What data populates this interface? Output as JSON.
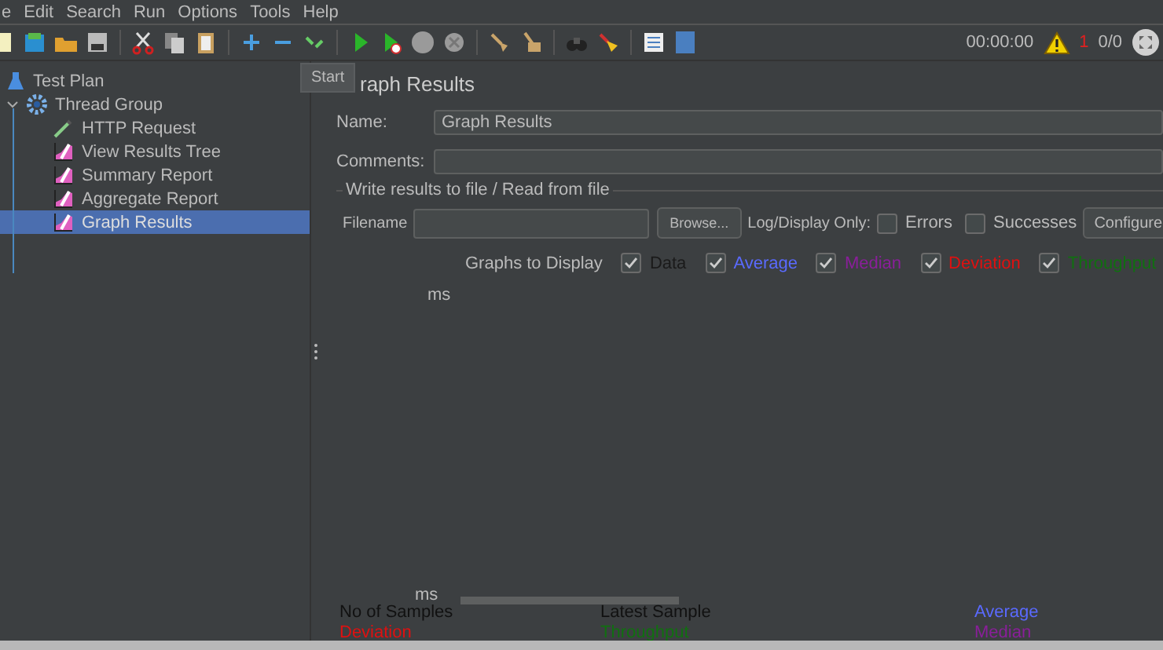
{
  "menu": [
    "e",
    "Edit",
    "Search",
    "Run",
    "Options",
    "Tools",
    "Help"
  ],
  "toolbar": {
    "tooltip": "Start",
    "timer": "00:00:00",
    "warning_count": "1",
    "threads": "0/0"
  },
  "tree": [
    {
      "label": "Test Plan",
      "kind": "plan",
      "selected": false
    },
    {
      "label": "Thread Group",
      "kind": "group",
      "expanded": true,
      "selected": false,
      "children": [
        {
          "label": "HTTP Request",
          "kind": "sampler",
          "selected": false
        },
        {
          "label": "View Results Tree",
          "kind": "listener",
          "selected": false
        },
        {
          "label": "Summary Report",
          "kind": "listener",
          "selected": false
        },
        {
          "label": "Aggregate Report",
          "kind": "listener",
          "selected": false
        },
        {
          "label": "Graph Results",
          "kind": "listener",
          "selected": true
        }
      ]
    }
  ],
  "panel": {
    "title": "raph Results",
    "name_label": "Name:",
    "name_value": "Graph Results",
    "comments_label": "Comments:",
    "file_group": "Write results to file / Read from file",
    "filename_label": "Filename",
    "browse": "Browse...",
    "log_label": "Log/Display Only:",
    "log_options": [
      {
        "label": "Errors",
        "checked": false
      },
      {
        "label": "Successes",
        "checked": false
      }
    ],
    "configure": "Configure",
    "graphs_label": "Graphs to Display",
    "graphs": [
      {
        "label": "Data",
        "checked": true,
        "color": "#1a1a1a"
      },
      {
        "label": "Average",
        "checked": true,
        "color": "#5a6aff"
      },
      {
        "label": "Median",
        "checked": true,
        "color": "#8a1f9a"
      },
      {
        "label": "Deviation",
        "checked": true,
        "color": "#e01010"
      },
      {
        "label": "Throughput",
        "checked": true,
        "color": "#107010"
      }
    ],
    "y_unit_top": "ms",
    "y_unit_bottom": "ms",
    "legend": [
      {
        "label": "No of Samples",
        "color": "#111111"
      },
      {
        "label": "Latest Sample",
        "color": "#111111"
      },
      {
        "label": "Average",
        "color": "#5a6aff"
      },
      {
        "label": "Deviation",
        "color": "#e01010"
      },
      {
        "label": "Throughput",
        "color": "#107010"
      },
      {
        "label": "Median",
        "color": "#8a1f9a"
      }
    ]
  }
}
